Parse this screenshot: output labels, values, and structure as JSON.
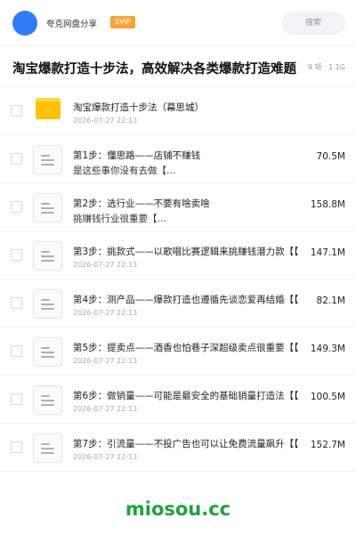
{
  "header": {
    "app_name": "夸克网盘分享",
    "badge": "SVIP",
    "search_placeholder": "搜索"
  },
  "page": {
    "title": "淘宝爆款打造十步法，高效解决各类爆款打造难题",
    "meta": "9 项 · 1.1G"
  },
  "folder": {
    "name": "淘宝爆款打造十步法（幕思城）",
    "date": "2026-07-27 22:13"
  },
  "files": [
    {
      "name": "第1步：懂思路——店铺不赚钱",
      "sub": "是这些事你没有去做【…",
      "size": "70.5M"
    },
    {
      "name": "第2步：选行业——不要有啥卖啥",
      "sub": "挑赚钱行业很重要【…",
      "size": "158.8M"
    },
    {
      "name": "第3步：挑款式——以歌唱比赛逻辑来挑赚钱潜力款【【",
      "sub": "2026-07-27 22:13",
      "size": "147.1M"
    },
    {
      "name": "第4步：测产品——爆款打造也遵循先谈恋爱再结婚【【",
      "sub": "2026-07-27 22:13",
      "size": "82.1M"
    },
    {
      "name": "第5步：提卖点——酒香也怕巷子深超级卖点很重要【【",
      "sub": "2026-07-27 22:13",
      "size": "149.3M"
    },
    {
      "name": "第6步：做销量——可能是最安全的基础销量打造法【【",
      "sub": "2026-07-27 22:13",
      "size": "100.5M"
    },
    {
      "name": "第7步：引流量——不投广告也可以让免费流量飙升【【",
      "sub": "2026-07-27 22:13",
      "size": "152.7M"
    }
  ],
  "watermark": "miosou.cc",
  "colors": {
    "accent": "#2f7cf6",
    "badge": "#f6a43a",
    "folder": "#ffc107",
    "watermark": "#1fa23a"
  }
}
